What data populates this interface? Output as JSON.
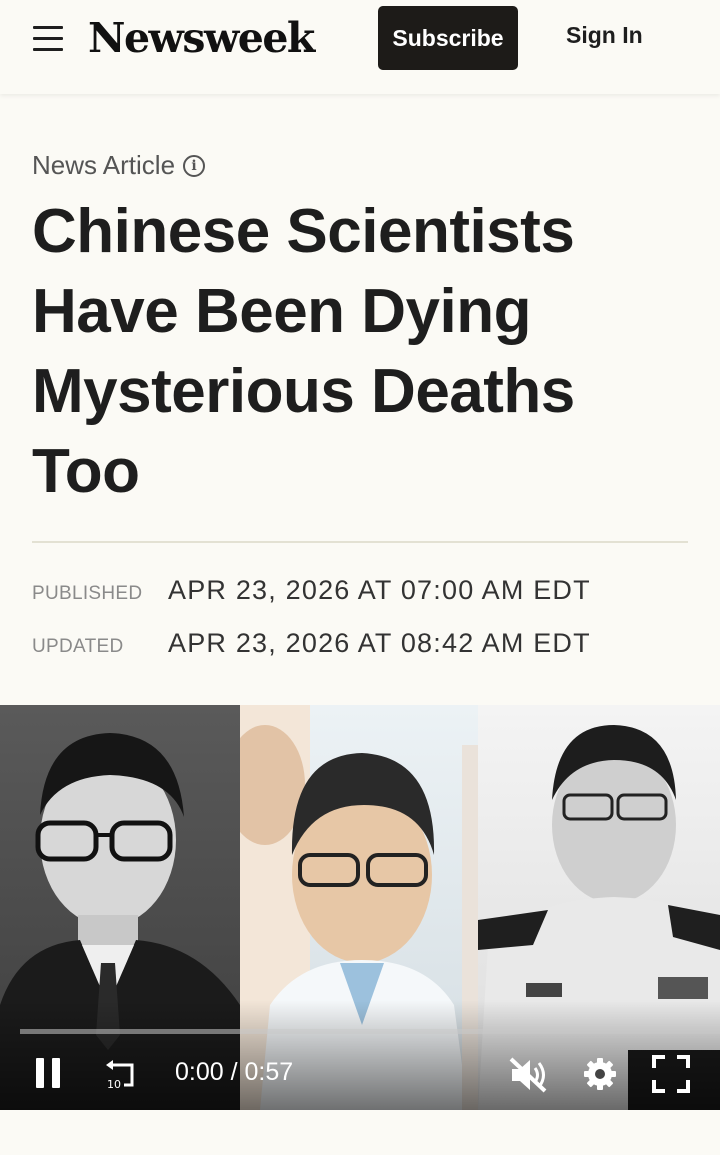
{
  "header": {
    "logo": "Newsweek",
    "subscribe_label": "Subscribe",
    "signin_label": "Sign In"
  },
  "article": {
    "kicker": "News Article",
    "headline": "Chinese Scientists Have Been Dying Mysterious Deaths Too",
    "published_label": "PUBLISHED",
    "published_value": "APR 23, 2026 AT 07:00 AM EDT",
    "updated_label": "UPDATED",
    "updated_value": "APR 23, 2026 AT 08:42 AM EDT"
  },
  "video": {
    "time": "0:00 / 0:57",
    "rewind_seconds": "10",
    "progress": 0,
    "muted": true
  },
  "icons": [
    "menu-icon",
    "info-icon",
    "pause-icon",
    "rewind-10-icon",
    "muted-speaker-icon",
    "gear-icon",
    "fullscreen-icon"
  ],
  "colors": {
    "background": "#fbfaf5",
    "text": "#1e1e1e",
    "button_dark": "#1d1b18",
    "meta_label": "#8a8a8a",
    "divider": "#e3e1d3"
  }
}
